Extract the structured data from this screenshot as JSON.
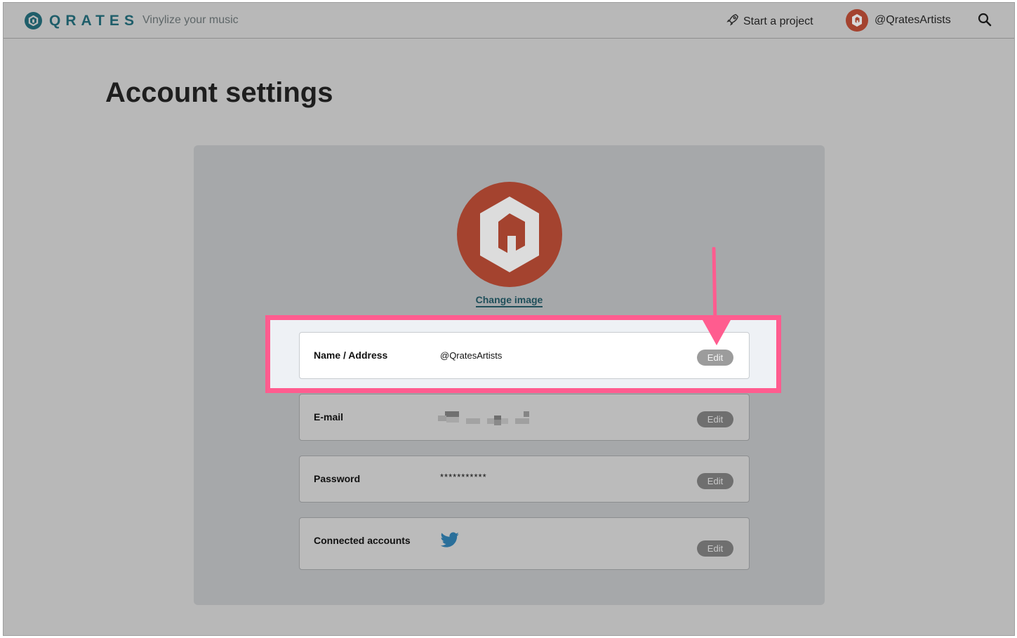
{
  "header": {
    "logo_text": "QRATES",
    "tagline": "Vinylize your music",
    "start_project": "Start a project",
    "username": "@QratesArtists"
  },
  "page": {
    "title": "Account settings"
  },
  "profile": {
    "change_image": "Change image"
  },
  "rows": [
    {
      "label": "Name / Address",
      "value": "@QratesArtists",
      "edit": "Edit"
    },
    {
      "label": "E-mail",
      "value": "",
      "edit": "Edit"
    },
    {
      "label": "Password",
      "value": "***********",
      "edit": "Edit"
    },
    {
      "label": "Connected accounts",
      "value": "",
      "edit": "Edit"
    }
  ],
  "colors": {
    "brand": "#1f5e6a",
    "highlight": "#ff5c8f",
    "avatar": "#a4432f",
    "twitter": "#1da1f2"
  },
  "icons": {
    "rocket": "rocket-icon",
    "search": "search-icon",
    "twitter": "twitter-icon"
  }
}
